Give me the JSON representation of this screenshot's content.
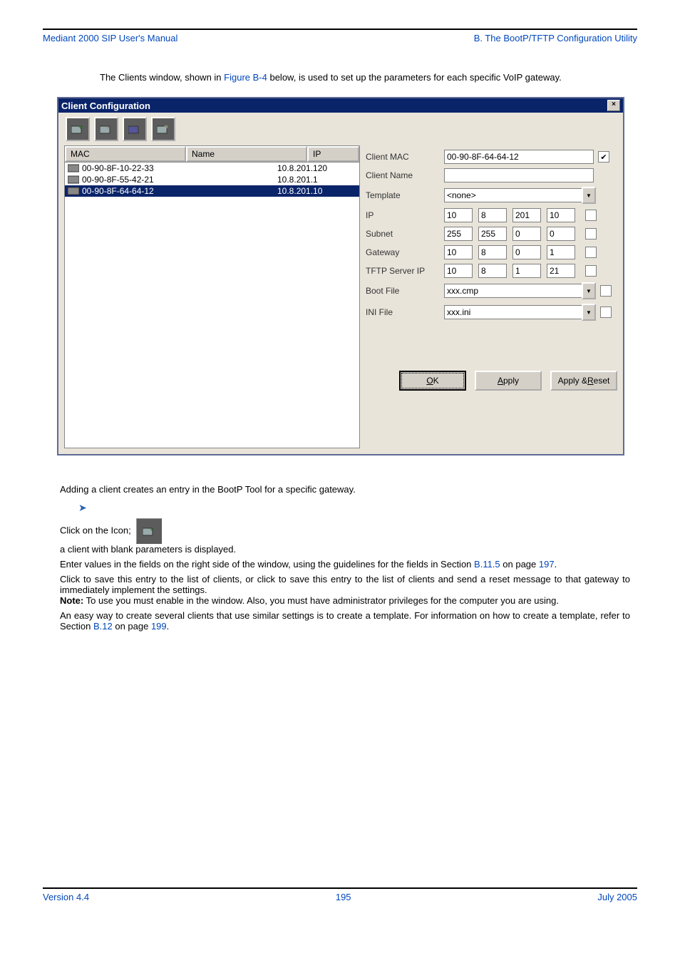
{
  "header": {
    "left": "Mediant 2000 SIP User's Manual",
    "right": "B. The BootP/TFTP Configuration Utility"
  },
  "intro": {
    "text_a": "The Clients window, shown in ",
    "figref": "Figure B-4",
    "text_b": " below, is used to set up the parameters for each specific VoIP gateway."
  },
  "dialog": {
    "title": "Client Configuration",
    "close_glyph": "×",
    "list": {
      "headers": {
        "mac": "MAC",
        "name": "Name",
        "ip": "IP"
      },
      "rows": [
        {
          "mac": "00-90-8F-10-22-33",
          "name": "",
          "ip": "10.8.201.120",
          "selected": false
        },
        {
          "mac": "00-90-8F-55-42-21",
          "name": "",
          "ip": "10.8.201.1",
          "selected": false
        },
        {
          "mac": "00-90-8F-64-64-12",
          "name": "",
          "ip": "10.8.201.10",
          "selected": true
        }
      ]
    },
    "form": {
      "client_mac": {
        "label": "Client MAC",
        "value": "00-90-8F-64-64-12",
        "checked": "✔"
      },
      "client_name": {
        "label": "Client Name",
        "value": ""
      },
      "template": {
        "label": "Template",
        "value": "<none>"
      },
      "ip": {
        "label": "IP",
        "a": "10",
        "b": "8",
        "c": "201",
        "d": "10"
      },
      "subnet": {
        "label": "Subnet",
        "a": "255",
        "b": "255",
        "c": "0",
        "d": "0"
      },
      "gateway": {
        "label": "Gateway",
        "a": "10",
        "b": "8",
        "c": "0",
        "d": "1"
      },
      "tftp": {
        "label": "TFTP Server IP",
        "a": "10",
        "b": "8",
        "c": "1",
        "d": "21"
      },
      "boot_file": {
        "label": "Boot File",
        "value": "xxx.cmp"
      },
      "ini_file": {
        "label": "INI File",
        "value": "xxx.ini"
      },
      "dropdown_glyph": "▼"
    },
    "buttons": {
      "ok": "OK",
      "apply": "Apply",
      "apply_reset": "Apply & Reset"
    }
  },
  "body": {
    "adding": "Adding a client creates an entry in the BootP Tool for a specific gateway.",
    "step1a": "Click on the ",
    "step1b": " Icon;",
    "step1c": "a client with blank parameters is displayed.",
    "step2a": "Enter values in the fields on the right side of the window, using the guidelines for the fields in Section ",
    "step2link": "B.11.5",
    "step2b": " on page ",
    "step2page": "197",
    "step2c": ".",
    "step3a": "Click ",
    "step3b": " to save this entry to the list of clients, or click ",
    "step3c": " to save this entry to the list of clients and send a reset message to that gateway to immediately implement the settings.",
    "note_label": "Note:",
    "note_a": " To use ",
    "note_b": " you must enable ",
    "note_c": " in the ",
    "note_d": " window. Also, you must have administrator privileges for the computer you are using.",
    "closing_a": "An easy way to create several clients that use similar settings is to create a template. For information on how to create a template, refer to Section ",
    "closing_link": "B.12",
    "closing_b": " on page ",
    "closing_page": "199",
    "closing_c": "."
  },
  "footer": {
    "version": "Version 4.4",
    "page": "195",
    "date": "July 2005"
  }
}
